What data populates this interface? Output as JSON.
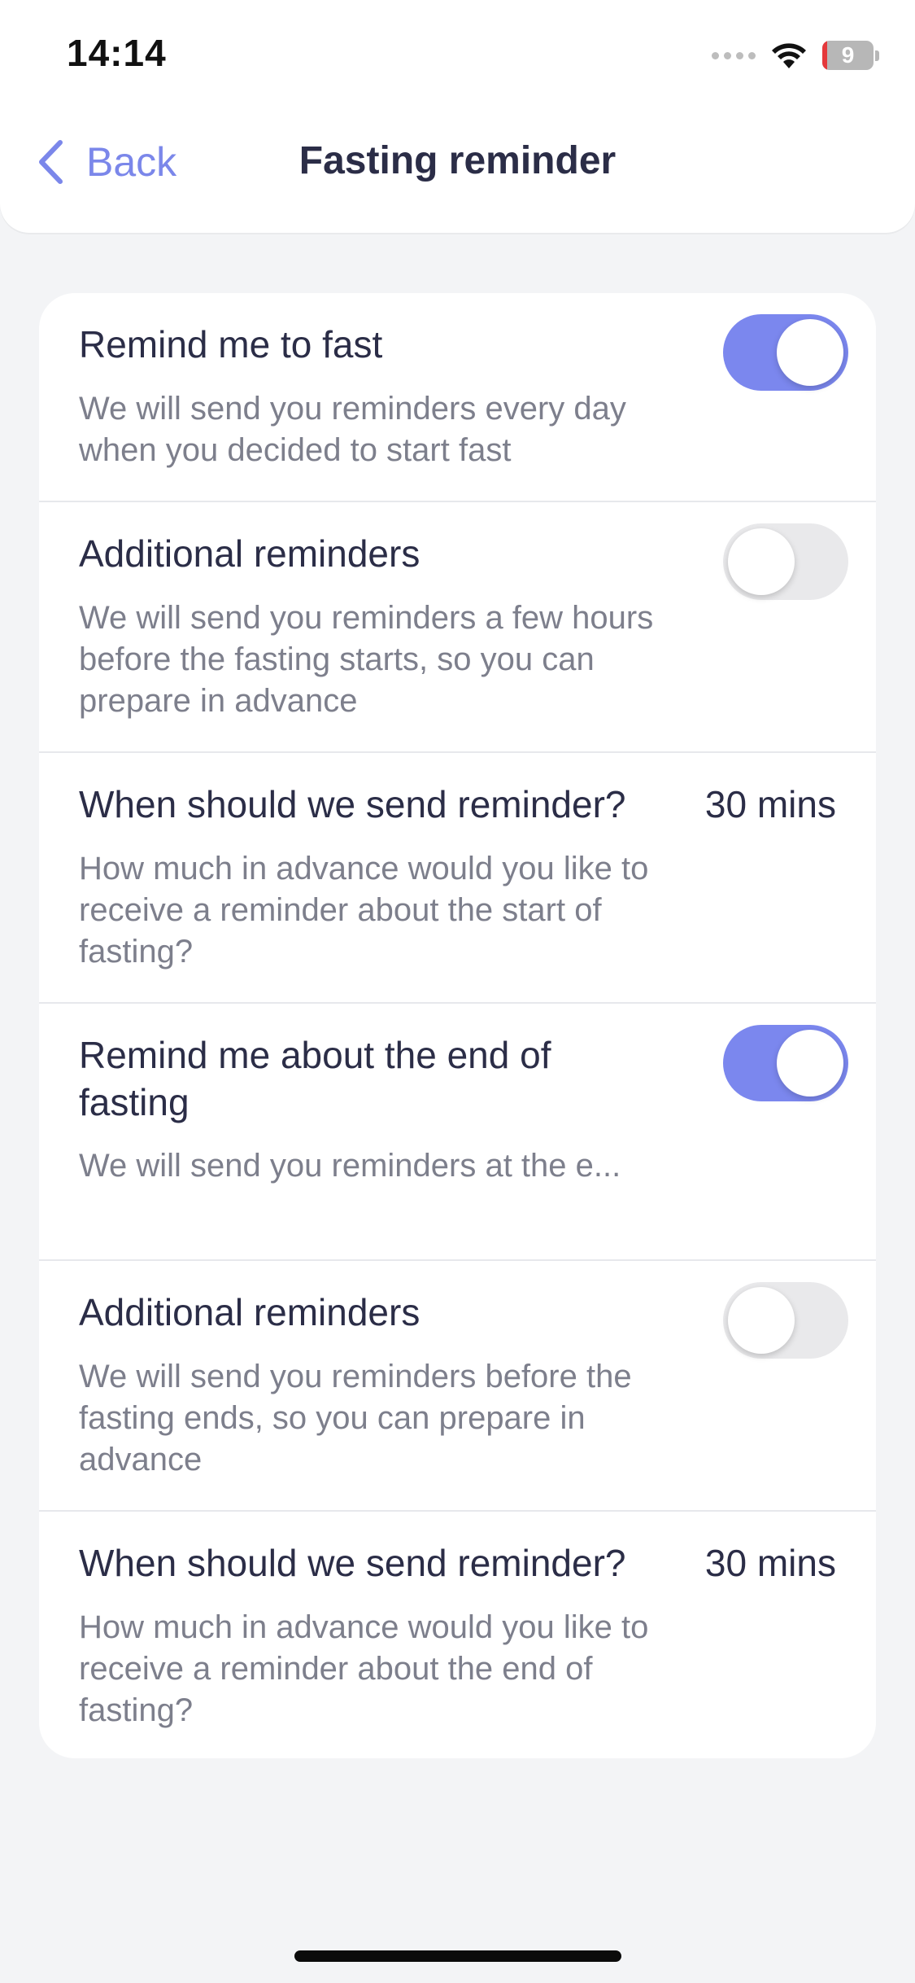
{
  "status_bar": {
    "time": "14:14",
    "battery_percent": 9,
    "battery_color": "#e5383b",
    "icons": [
      "signal-icon",
      "wifi-icon",
      "battery-icon"
    ]
  },
  "nav": {
    "back_label": "Back",
    "title": "Fasting reminder",
    "accent_color": "#7b87ea"
  },
  "settings": [
    {
      "type": "toggle",
      "title": "Remind me to fast",
      "description": "We will send you reminders every day when you decided to start fast",
      "enabled": true
    },
    {
      "type": "toggle",
      "title": "Additional reminders",
      "description": "We will send you reminders a few hours before the fasting starts, so you can prepare in advance",
      "enabled": false
    },
    {
      "type": "value",
      "title": "When should we send reminder?",
      "description": "How much in advance would you like to receive a reminder about the start of fasting?",
      "value": "30 mins"
    },
    {
      "type": "toggle",
      "title": "Remind me about the end of fasting",
      "description": "We will send you reminders at the e...",
      "enabled": true
    },
    {
      "type": "toggle",
      "title": "Additional reminders",
      "description": "We will send you reminders before the fasting ends, so you can prepare in advance",
      "enabled": false
    },
    {
      "type": "value",
      "title": "When should we send reminder?",
      "description": "How much in advance would you like to receive a reminder about the end of fasting?",
      "value": "30 mins"
    }
  ]
}
